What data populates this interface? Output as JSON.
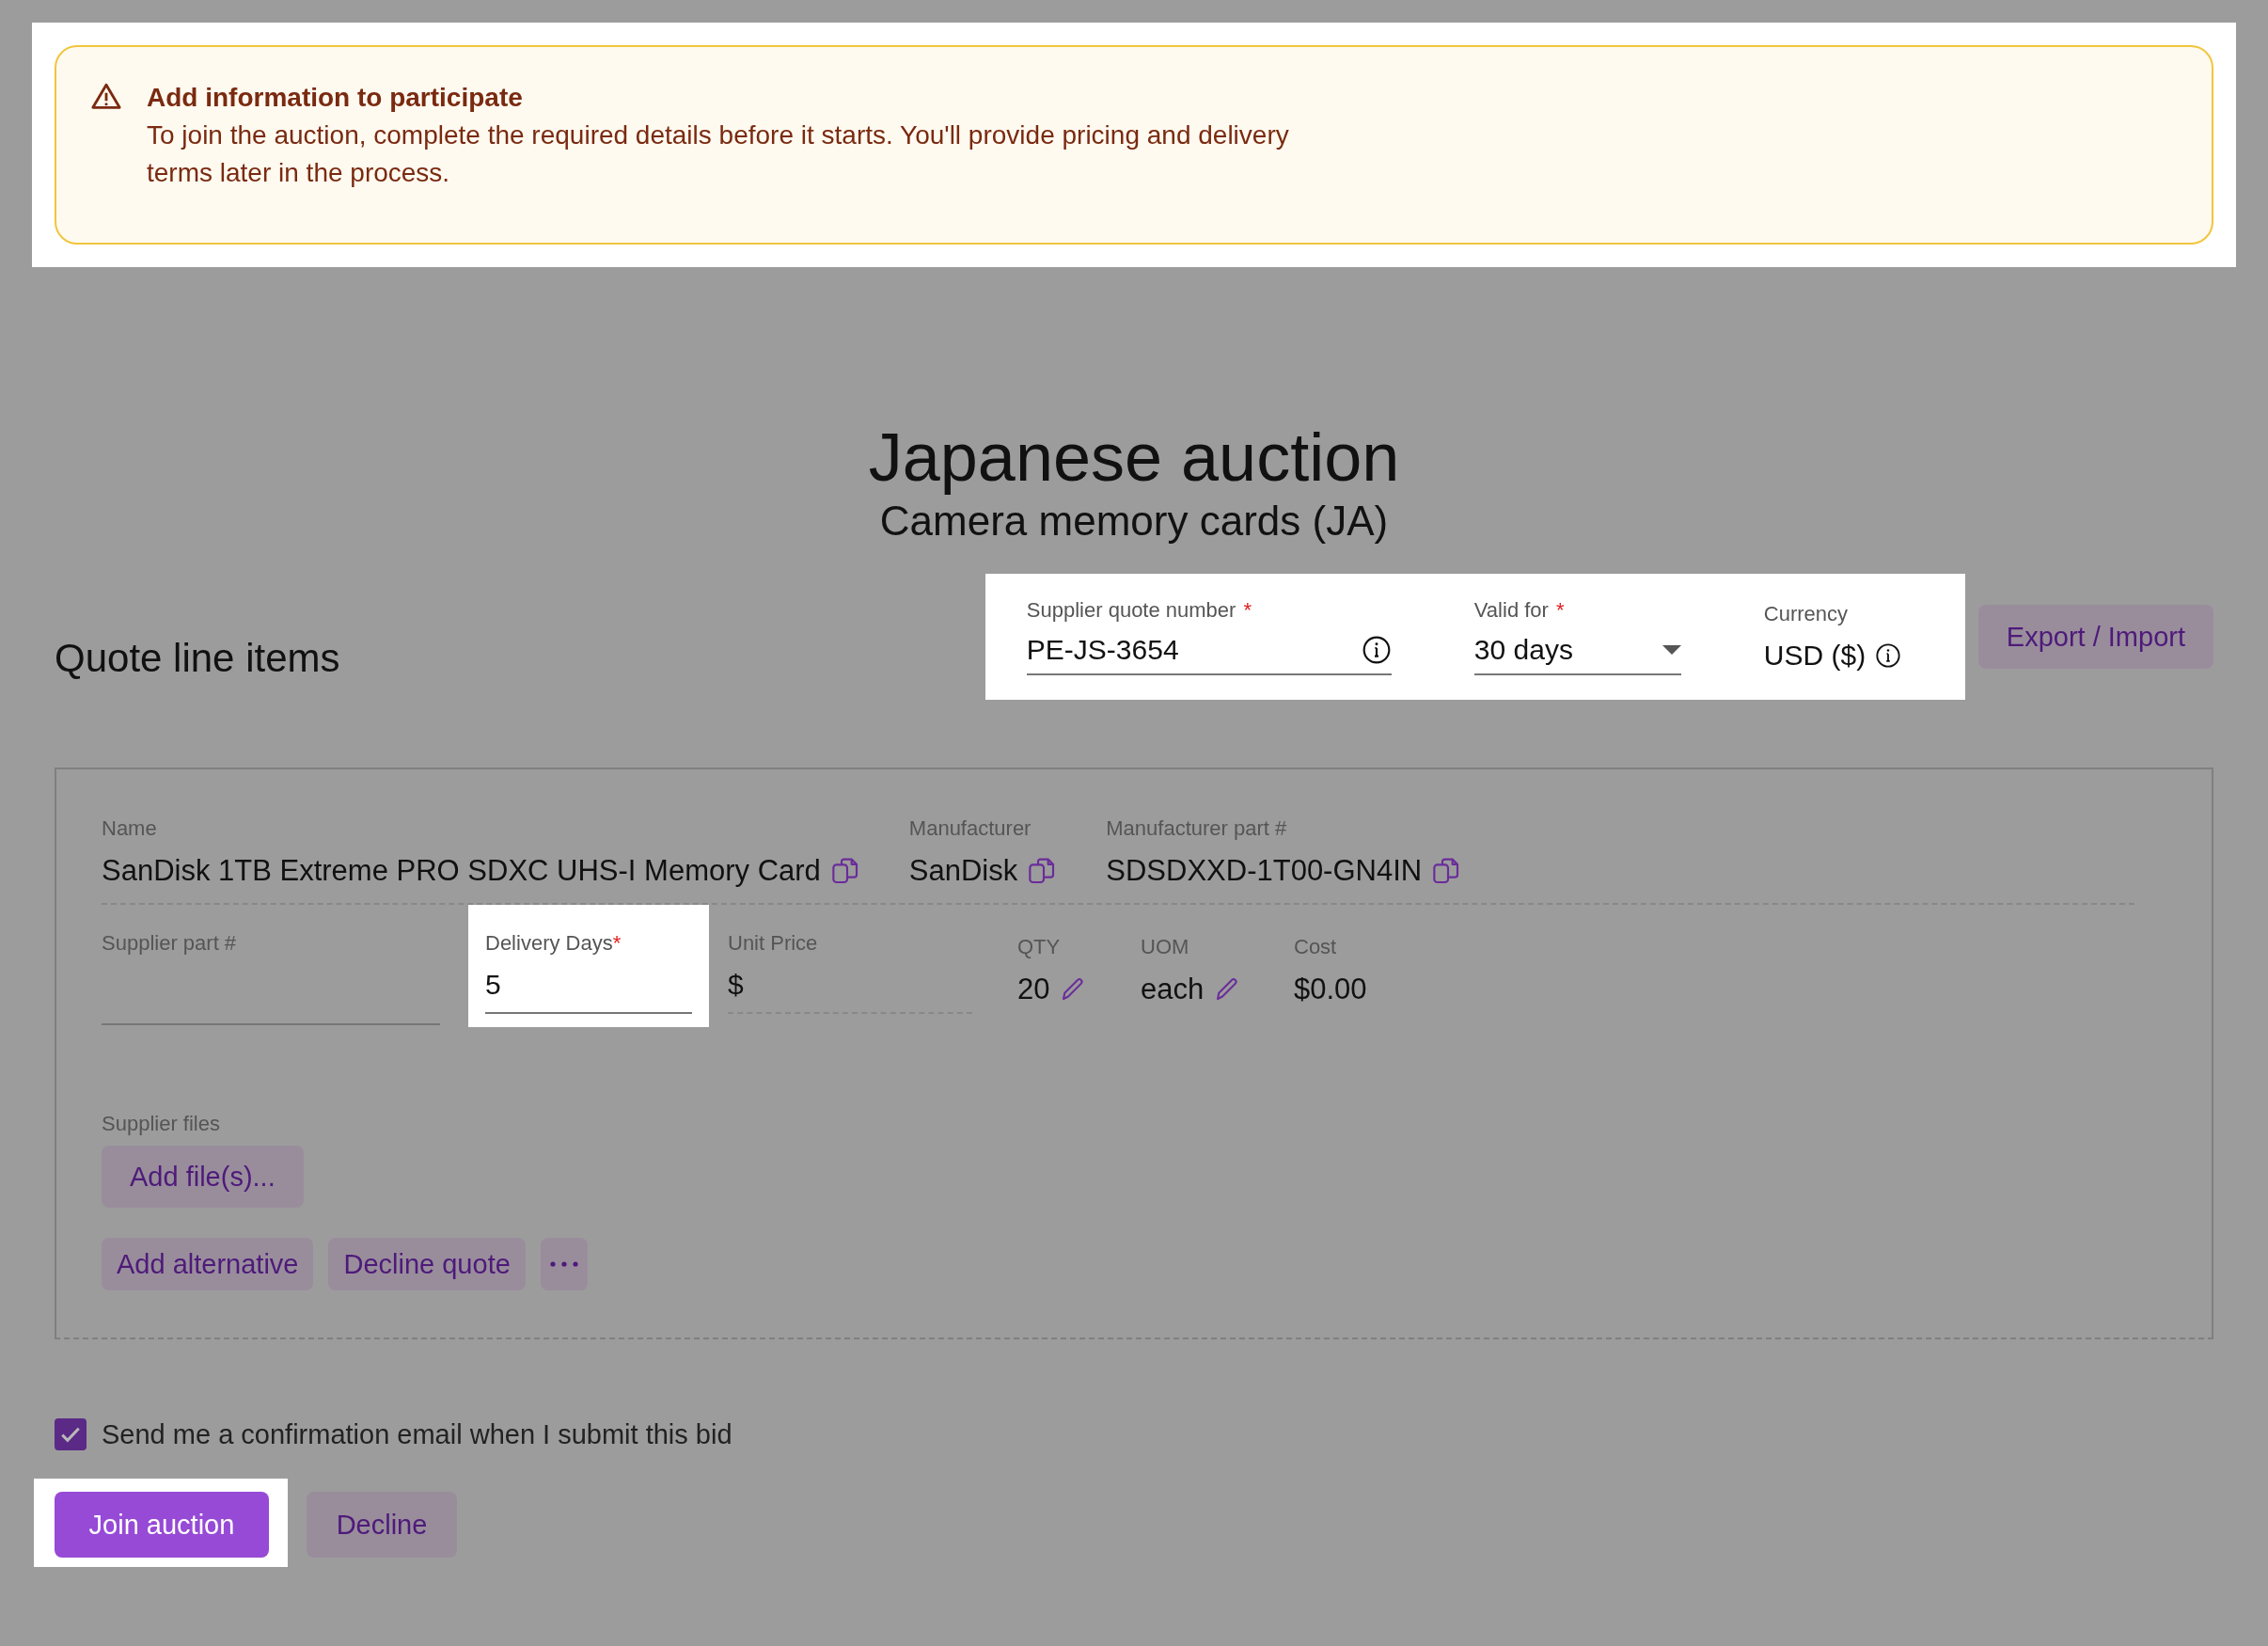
{
  "alert": {
    "title": "Add information to participate",
    "message": "To join the auction, complete the required details before it starts. You'll provide pricing and delivery terms later in the process.",
    "highlighted": true
  },
  "page": {
    "title": "Japanese auction",
    "subtitle": "Camera memory cards (JA)"
  },
  "section_title": "Quote line items",
  "required_mark": "*",
  "quote_header": {
    "highlighted": true,
    "fields": [
      {
        "kind": "text",
        "label": "Supplier quote number",
        "required": true,
        "value": "PE-JS-3654"
      },
      {
        "kind": "select",
        "label": "Valid for",
        "required": true,
        "value": "30 days"
      },
      {
        "kind": "static",
        "label": "Currency",
        "required": false,
        "value": "USD ($)"
      }
    ]
  },
  "export_button": "Export / Import",
  "line_item": {
    "info": [
      {
        "label": "Name",
        "value": "SanDisk 1TB Extreme PRO SDXC UHS-I Memory Card"
      },
      {
        "label": "Manufacturer",
        "value": "SanDisk"
      },
      {
        "label": "Manufacturer part #",
        "value": "SDSDXXD-1T00-GN4IN"
      }
    ],
    "fields": [
      {
        "kind": "input",
        "label": "Supplier part #",
        "required": false,
        "highlighted": false
      },
      {
        "kind": "input",
        "label": "Delivery Days",
        "required": true,
        "highlighted": true,
        "value": "5"
      },
      {
        "kind": "price",
        "label": "Unit Price",
        "required": false,
        "highlighted": false,
        "prefix": "$"
      },
      {
        "kind": "editable",
        "label": "QTY",
        "required": false,
        "highlighted": false,
        "value": "20"
      },
      {
        "kind": "editable",
        "label": "UOM",
        "required": false,
        "highlighted": false,
        "value": "each"
      },
      {
        "kind": "static",
        "label": "Cost",
        "required": false,
        "highlighted": false,
        "value": "$0.00"
      }
    ],
    "files_label": "Supplier files",
    "add_files_button": "Add file(s)...",
    "actions": [
      "Add alternative",
      "Decline quote"
    ]
  },
  "confirmation": {
    "label": "Send me a confirmation email when I submit this bid",
    "checked": true
  },
  "buttons": [
    {
      "label": "Join auction",
      "kind": "primary",
      "highlighted": true
    },
    {
      "label": "Decline",
      "kind": "secondary",
      "highlighted": false
    }
  ]
}
